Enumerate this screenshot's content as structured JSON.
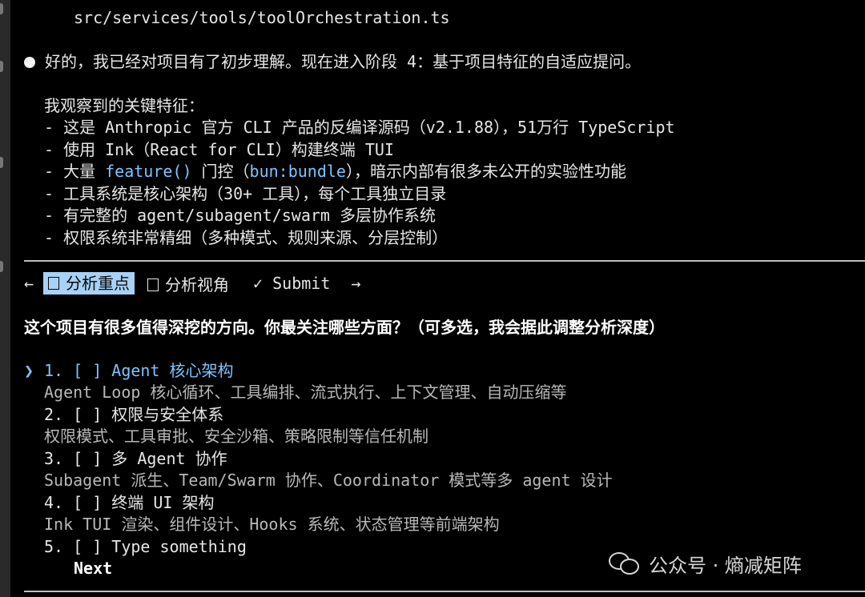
{
  "header_path": "src/services/tools/toolOrchestration.ts",
  "message": {
    "intro": "好的，我已经对项目有了初步理解。现在进入阶段 4：基于项目特征的自适应提问。",
    "features_title": "我观察到的关键特征：",
    "feature1": "- 这是 Anthropic 官方 CLI 产品的反编译源码（v2.1.88），51万行 TypeScript",
    "feature2": "- 使用 Ink（React for CLI）构建终端 TUI",
    "feature3_prefix": "- 大量 ",
    "feature3_code1": "feature()",
    "feature3_mid": " 门控（",
    "feature3_code2": "bun:bundle",
    "feature3_suffix": "），暗示内部有很多未公开的实验性功能",
    "feature4": "- 工具系统是核心架构（30+ 工具），每个工具独立目录",
    "feature5": "- 有完整的 agent/subagent/swarm 多层协作系统",
    "feature6": "- 权限系统非常精细（多种模式、规则来源、分层控制）"
  },
  "tabs": {
    "left_arrow": "←",
    "tab1": "分析重点",
    "tab2": "分析视角",
    "submit": "✓ Submit",
    "right_arrow": "→"
  },
  "question": "这个项目有很多值得深挖的方向。你最关注哪些方面？（可多选，我会据此调整分析深度）",
  "cursor": "❯",
  "options": [
    {
      "label": "1. [ ] Agent 核心架构",
      "desc": "Agent Loop 核心循环、工具编排、流式执行、上下文管理、自动压缩等"
    },
    {
      "label": "2. [ ] 权限与安全体系",
      "desc": "权限模式、工具审批、安全沙箱、策略限制等信任机制"
    },
    {
      "label": "3. [ ] 多 Agent 协作",
      "desc": "Subagent 派生、Team/Swarm 协作、Coordinator 模式等多 agent 设计"
    },
    {
      "label": "4. [ ] 终端 UI 架构",
      "desc": "Ink TUI 渲染、组件设计、Hooks 系统、状态管理等前端架构"
    },
    {
      "label": "5. [ ] Type something",
      "desc": ""
    }
  ],
  "next_label": "Next",
  "watermark": {
    "text": "公众号 · 熵减矩阵"
  }
}
